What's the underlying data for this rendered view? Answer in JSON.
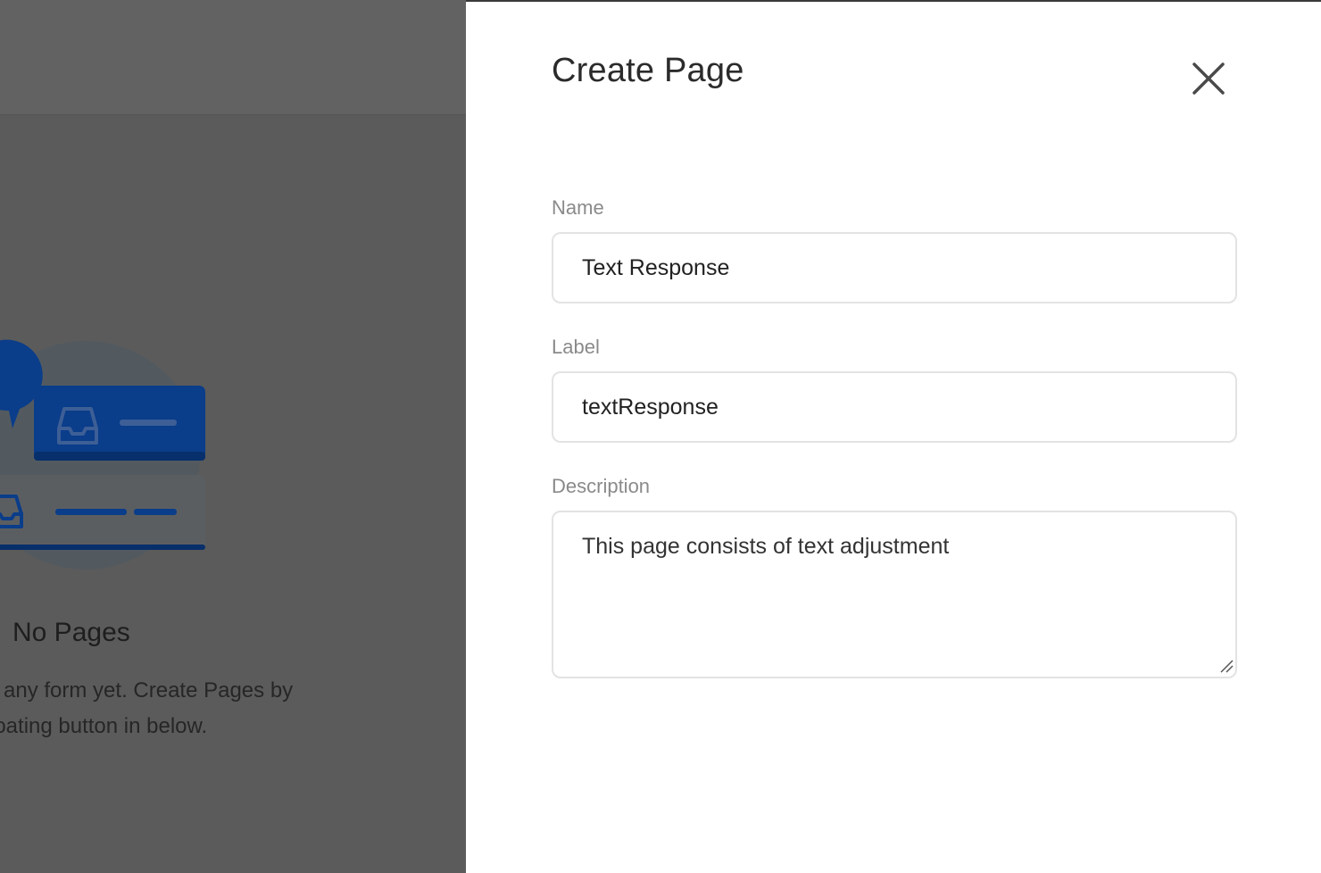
{
  "background": {
    "empty_state": {
      "title": "No Pages",
      "text_line1": "ve any form yet. Create Pages by",
      "text_line2": "loating button in below."
    },
    "colors": {
      "illustration_blue": "#0a3d8a",
      "illustration_circle": "#525a60"
    }
  },
  "drawer": {
    "title": "Create Page",
    "close_icon": "close-icon",
    "fields": {
      "name": {
        "label": "Name",
        "value": "Text Response"
      },
      "label": {
        "label": "Label",
        "value": "textResponse"
      },
      "description": {
        "label": "Description",
        "value": "This page consists of text adjustment"
      }
    }
  }
}
